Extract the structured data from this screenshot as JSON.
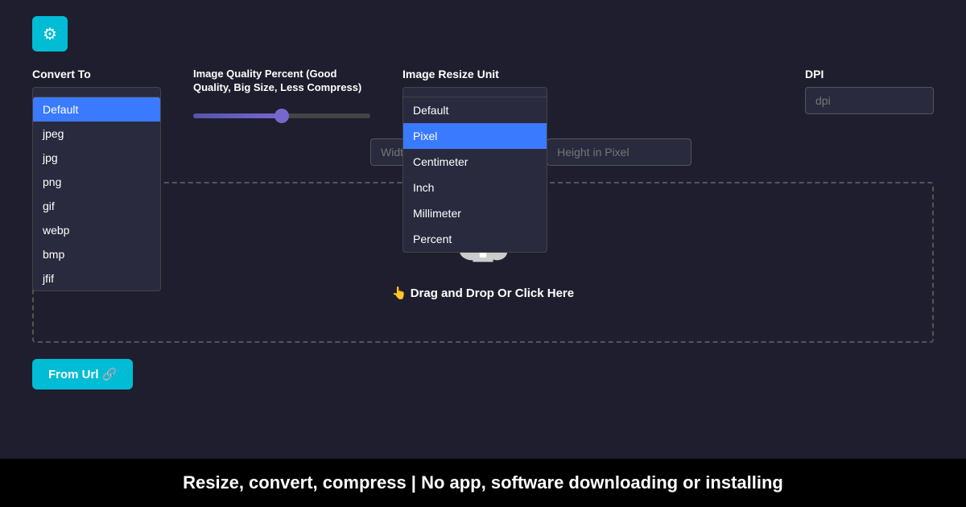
{
  "gear_button": {
    "label": "⚙"
  },
  "convert_to": {
    "label": "Convert To",
    "selected": "Default",
    "options": [
      "Default",
      "jpeg",
      "jpg",
      "png",
      "gif",
      "webp",
      "bmp",
      "jfif"
    ]
  },
  "image_quality": {
    "label": "Image Quality Percent (Good Quality, Big Size, Less Compress)",
    "value": 50
  },
  "image_resize_unit": {
    "label": "Image Resize Unit",
    "selected": "Pixel",
    "options": [
      "Default",
      "Pixel",
      "Centimeter",
      "Inch",
      "Millimeter",
      "Percent"
    ]
  },
  "dpi": {
    "label": "DPI",
    "placeholder": "dpi"
  },
  "width_input": {
    "placeholder": "Width in Pixel"
  },
  "height_input": {
    "placeholder": "Height in Pixel"
  },
  "upload_area": {
    "icon": "☁",
    "text": "👆 Drag and Drop Or Click Here"
  },
  "from_url_button": {
    "label": "From Url 🔗"
  },
  "footer": {
    "text": "Resize, convert, compress | No app, software downloading or installing"
  }
}
